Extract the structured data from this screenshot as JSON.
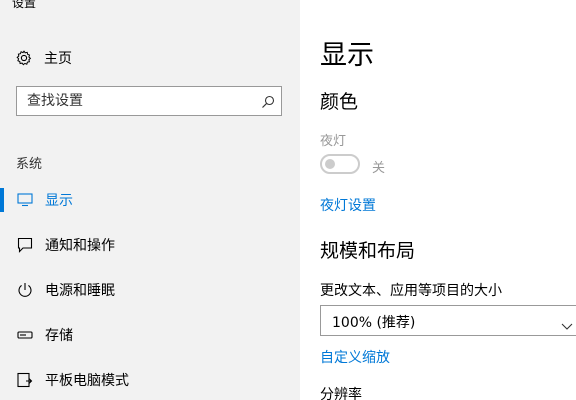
{
  "window": {
    "title": "设置"
  },
  "sidebar": {
    "home": {
      "label": "主页",
      "icon": "gear-icon"
    },
    "search": {
      "placeholder": "查找设置",
      "icon": "search-icon"
    },
    "section_title": "系统",
    "items": [
      {
        "label": "显示",
        "icon": "monitor-icon",
        "active": true
      },
      {
        "label": "通知和操作",
        "icon": "notification-icon",
        "active": false
      },
      {
        "label": "电源和睡眠",
        "icon": "power-icon",
        "active": false
      },
      {
        "label": "存储",
        "icon": "storage-icon",
        "active": false
      },
      {
        "label": "平板电脑模式",
        "icon": "tablet-mode-icon",
        "active": false
      }
    ]
  },
  "main": {
    "page_title": "显示",
    "color_heading": "颜色",
    "night_light": {
      "label": "夜灯",
      "state_text": "关",
      "on": false
    },
    "night_light_settings_link": "夜灯设置",
    "scale_heading": "规模和布局",
    "scale_label": "更改文本、应用等项目的大小",
    "scale_dropdown": {
      "selected": "100% (推荐)"
    },
    "custom_scaling_link": "自定义缩放",
    "resolution_label": "分辨率"
  },
  "colors": {
    "accent": "#0078d7",
    "sidebar_bg": "#f2f2f2",
    "disabled_text": "#999999"
  }
}
